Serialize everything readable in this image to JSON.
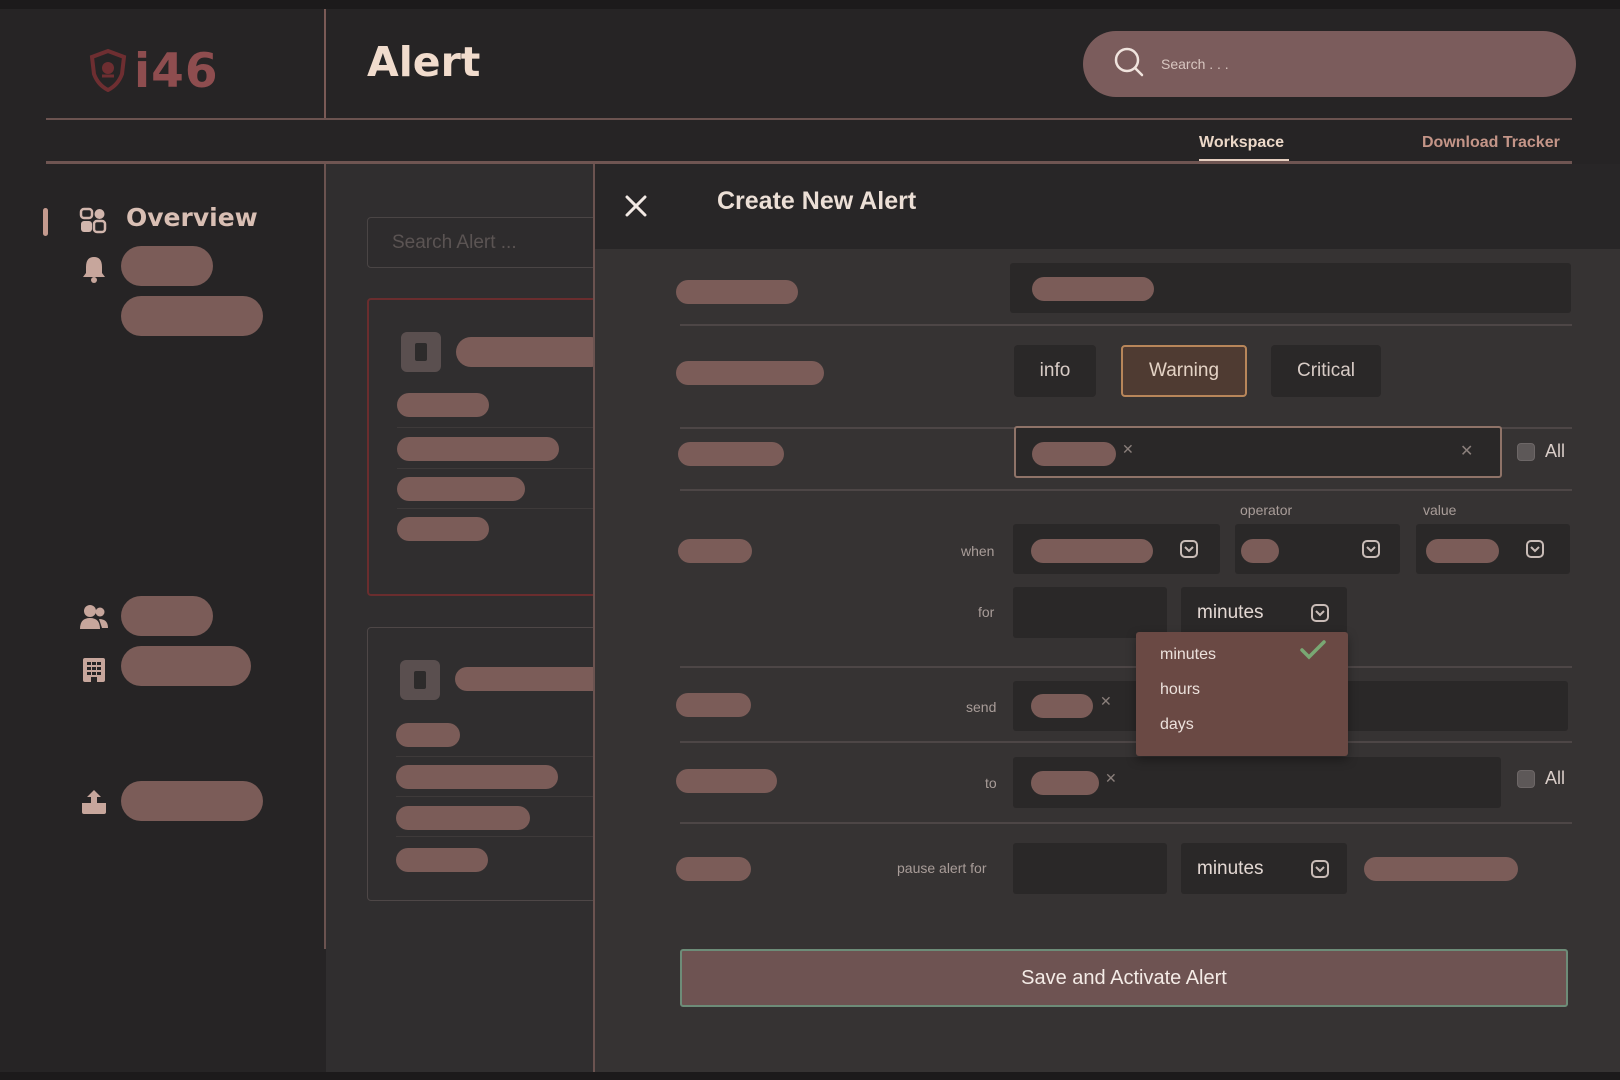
{
  "app": {
    "logo_text": "i46",
    "page_title": "Alert",
    "search_placeholder": "Search . . ."
  },
  "tabs": [
    {
      "label": "Workspace",
      "active": true
    },
    {
      "label": "Download Tracker",
      "active": false
    }
  ],
  "sidebar": {
    "active_item": "Overview",
    "icons": [
      "overview-icon",
      "bell-icon",
      "users-icon",
      "building-icon",
      "upload-icon"
    ]
  },
  "alert_list": {
    "search_placeholder": "Search Alert ..."
  },
  "modal": {
    "title": "Create New Alert",
    "severity_options": [
      "info",
      "Warning",
      "Critical"
    ],
    "selected_severity": "Warning",
    "all_label_1": "All",
    "all_label_2": "All",
    "labels": {
      "operator": "operator",
      "value": "value",
      "when": "when",
      "for": "for",
      "send": "send",
      "to": "to",
      "pause": "pause alert for"
    },
    "for_unit": "minutes",
    "pause_unit": "minutes",
    "unit_dropdown": {
      "options": [
        "minutes",
        "hours",
        "days"
      ],
      "selected": "minutes"
    },
    "save_label": "Save and Activate Alert"
  },
  "colors": {
    "background": "#262425",
    "accent": "#7b5c58",
    "logo": "#8e4d4f",
    "warning_border": "#b8865a",
    "save_border": "#6d8c78"
  }
}
